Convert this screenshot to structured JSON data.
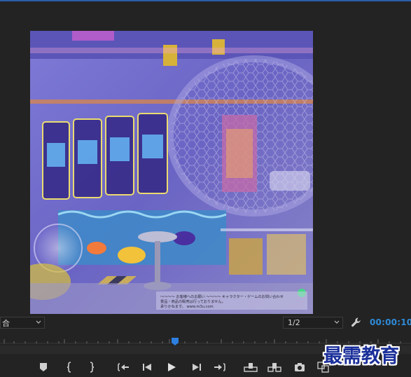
{
  "program_monitor": {
    "zoom": {
      "value": "合"
    },
    "resolution": {
      "value": "1/2"
    },
    "timecode": "00:00:10:",
    "preview_caption_lines": [
      "～～～～ お客様へのお願い ～～～～ キャラクター・ゲームのお問い合わせ",
      "景品・商品の販売は行っておりません。",
      "承りかねます。 www.m3u.com"
    ]
  },
  "transport": {
    "buttons": [
      "add-marker",
      "mark-in",
      "mark-out",
      "go-to-in",
      "step-back",
      "play",
      "step-forward",
      "go-to-out",
      "lift",
      "extract",
      "export-frame",
      "comparison-view"
    ]
  },
  "watermark": {
    "text": "最需教育"
  },
  "colors": {
    "panel": "#232323",
    "timecode": "#2e8bd8",
    "playhead": "#2d7fe0",
    "watermark": "#1a2f9a"
  }
}
